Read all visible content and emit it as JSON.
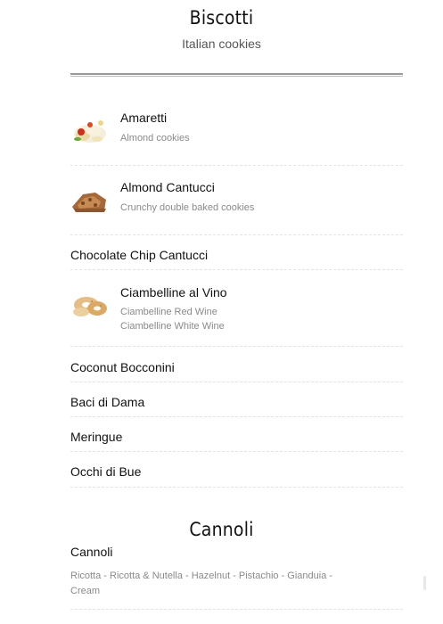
{
  "biscotti": {
    "title": "Biscotti",
    "subtitle": "Italian cookies",
    "items": [
      {
        "name": "Amaretti",
        "desc": [
          "Almond cookies"
        ],
        "icon": "amaretti-cookie-image"
      },
      {
        "name": "Almond Cantucci",
        "desc": [
          "Crunchy double baked cookies"
        ],
        "icon": "cantucci-cookie-image"
      },
      {
        "name": "Chocolate Chip Cantucci",
        "desc": []
      },
      {
        "name": "Ciambelline al Vino",
        "desc": [
          "Ciambelline Red Wine",
          "Ciambelline White Wine"
        ],
        "icon": "ciambelline-cookie-image"
      },
      {
        "name": "Coconut Bocconini",
        "desc": []
      },
      {
        "name": "Baci di Dama",
        "desc": []
      },
      {
        "name": "Meringue",
        "desc": []
      },
      {
        "name": "Occhi di Bue",
        "desc": []
      }
    ]
  },
  "cannoli": {
    "title": "Cannoli",
    "item": {
      "name": "Cannoli",
      "desc": "Ricotta - Ricotta & Nutella - Hazelnut - Pistachio - Gianduia - Cream"
    }
  }
}
